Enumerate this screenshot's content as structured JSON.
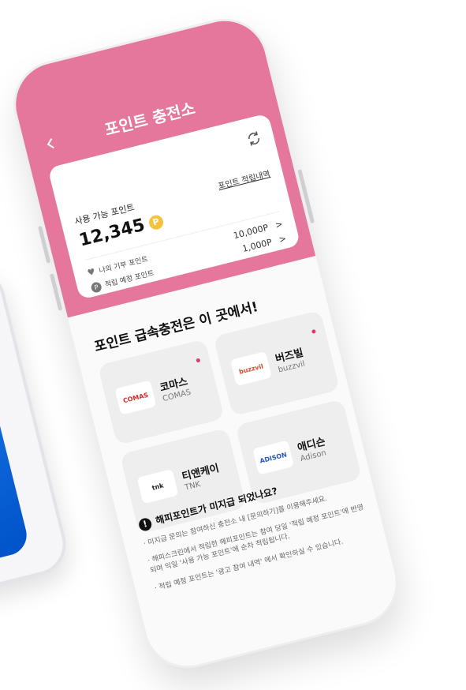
{
  "header": {
    "title": "포인트 충전소"
  },
  "summary": {
    "available_label": "사용 가능 포인트",
    "available_points": "12,345",
    "coin_icon_text": "P",
    "history_link": "포인트 적립내역",
    "donation_label": "나의 기부 포인트",
    "donation_value": "10,000P",
    "pending_label": "적립 예정 포인트",
    "pending_icon_text": "P",
    "pending_value": "1,000P",
    "chevron": ">"
  },
  "section": {
    "title": "포인트 급속충전은 이 곳에서!"
  },
  "partners": [
    {
      "name": "코마스",
      "sub": "COMAS",
      "logo_text": "COMAS",
      "logo_color": "#d72a2a",
      "new_dot": true
    },
    {
      "name": "버즈빌",
      "sub": "buzzvil",
      "logo_text": "buzzvil",
      "logo_color": "#d94a2b",
      "new_dot": true
    },
    {
      "name": "티앤케이",
      "sub": "TNK",
      "logo_text": "tnk",
      "logo_color": "#222222",
      "new_dot": false
    },
    {
      "name": "애디슨",
      "sub": "Adison",
      "logo_text": "ADISON",
      "logo_color": "#2a57c9",
      "new_dot": false
    }
  ],
  "notice": {
    "title": "해피포인트가 미지급 되었나요?",
    "icon_text": "!",
    "lines": [
      "· 미지급 문의는 참여하신 충전소 내 [문의하기]를 이용해주세요.",
      "· 해피스크린에서 적립한 해피포인트는 참여 당일 '적립 예정 포인트'에 반영되며 익일 '사용 가능 포인트'에 순차 적립됩니다.",
      "· 적립 예정 포인트는 '광고 참여 내역' 에서 확인하실 수 있습니다."
    ]
  },
  "colors": {
    "header": "#e6779c",
    "coin": "#f5c33b",
    "dot": "#e0386c",
    "bg_phone_screen": "#0a64e0"
  }
}
